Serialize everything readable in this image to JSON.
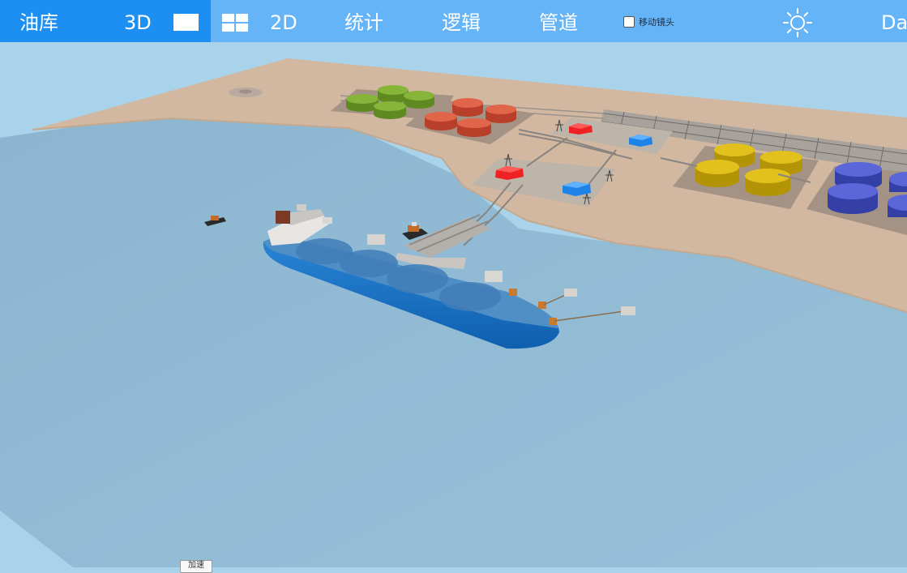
{
  "topbar": {
    "title": "油库",
    "mode_3d": "3D",
    "mode_2d": "2D",
    "menu_stats": "统计",
    "menu_logic": "逻辑",
    "menu_pipeline": "管道",
    "camera_label": "移动镜头",
    "camera_checked": false,
    "day_label": "Day",
    "icons": {
      "single_view": "single-view-icon",
      "quad_view": "quad-view-icon",
      "theme": "sun-icon"
    }
  },
  "scene": {
    "colors": {
      "sky": "#a9d3ea",
      "water": "#8fbad5",
      "land": "#d2b8a1",
      "tank_green": "#7aa82d",
      "tank_red": "#d9583a",
      "tank_yellow": "#d8b411",
      "tank_blue": "#4a55c8",
      "ship_hull": "#1e73c8",
      "building_red": "#ee2222",
      "building_blue": "#1e82e6"
    }
  },
  "footer": {
    "speed_button": "加速"
  }
}
